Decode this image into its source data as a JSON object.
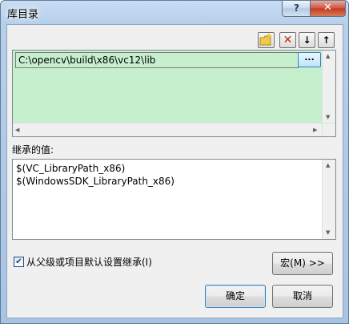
{
  "window": {
    "title": "库目录",
    "help_glyph": "?",
    "close_glyph": "✕"
  },
  "toolbar": {
    "new_line_icon": "folder-new-icon",
    "delete_icon": "delete-x-icon",
    "move_down_icon": "arrow-down-icon",
    "move_up_icon": "arrow-up-icon",
    "delete_glyph": "✕",
    "down_glyph": "↓",
    "up_glyph": "↑"
  },
  "editor": {
    "entries": [
      "C:\\opencv\\build\\x86\\vc12\\lib"
    ],
    "browse_label": "..."
  },
  "inherited": {
    "label": "继承的值:",
    "values": [
      "$(VC_LibraryPath_x86)",
      "$(WindowsSDK_LibraryPath_x86)"
    ]
  },
  "inherit_checkbox": {
    "label": "从父级或项目默认设置继承(I)",
    "checked": true,
    "check_glyph": "✔"
  },
  "buttons": {
    "macro": "宏(M) >>",
    "ok": "确定",
    "cancel": "取消"
  },
  "scroll_glyphs": {
    "left": "◀",
    "right": "▶",
    "up": "▲",
    "down": "▼"
  },
  "colors": {
    "edit_background": "#c6efce",
    "delete_red": "#c42b1c",
    "title_gradient": "#b6cfea"
  }
}
